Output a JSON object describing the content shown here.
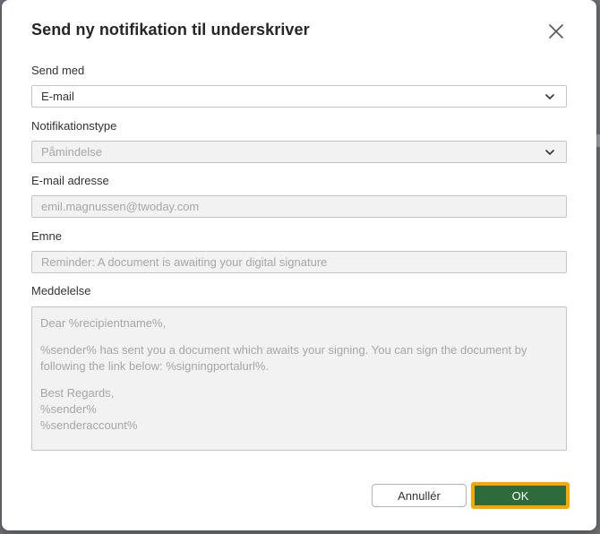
{
  "dialog": {
    "title": "Send ny notifikation til underskriver",
    "close_icon": "close-icon"
  },
  "form": {
    "send_with": {
      "label": "Send med",
      "value": "E-mail",
      "icon": "chevron-down-icon"
    },
    "notification_type": {
      "label": "Notifikationstype",
      "value": "Påmindelse",
      "icon": "chevron-down-icon"
    },
    "email": {
      "label": "E-mail adresse",
      "value": "emil.magnussen@twoday.com"
    },
    "subject": {
      "label": "Emne",
      "value": "Reminder: A document is awaiting your digital signature"
    },
    "message": {
      "label": "Meddelelse",
      "greeting": "Dear %recipientname%,",
      "body": "%sender% has sent you a document which awaits your signing. You can sign the document by following the link below: %signingportalurl%.",
      "closing": "Best Regards,",
      "sender": "%sender%",
      "sender_account": "%senderaccount%"
    }
  },
  "actions": {
    "cancel_label": "Annullér",
    "ok_label": "OK"
  },
  "colors": {
    "ok_background": "#2e6b3a",
    "focus_ring": "#f5a800",
    "disabled_field": "#f2f2f2"
  }
}
